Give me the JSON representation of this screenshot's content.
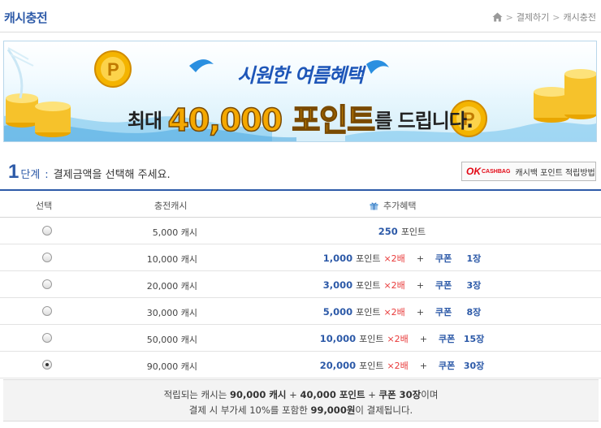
{
  "header": {
    "title": "캐시충전",
    "breadcrumb": [
      "결제하기",
      "캐시충전"
    ]
  },
  "banner": {
    "headline": "시원한 여름혜택",
    "sub_prefix": "최대",
    "sub_amount": "40,000 포인트",
    "sub_suffix": "를 드립니다."
  },
  "step": {
    "number": "1",
    "label": "단계",
    "colon": ":",
    "instruction": "결제금액을 선택해 주세요."
  },
  "okcashbag": {
    "logo_ok": "OK",
    "logo_cashbag": "CASHBAG",
    "label": "캐시백 포인트 적립방법"
  },
  "table": {
    "headers": {
      "select": "선택",
      "cash": "충전캐시",
      "bonus": "추가혜택"
    },
    "rows": [
      {
        "cash": "5,000 캐시",
        "points": "250",
        "unit": "포인트",
        "mult": "",
        "coupon": "",
        "coupon_count": "",
        "selected": false
      },
      {
        "cash": "10,000 캐시",
        "points": "1,000",
        "unit": "포인트",
        "mult": "×2배",
        "coupon": "쿠폰",
        "coupon_count": "1장",
        "selected": false
      },
      {
        "cash": "20,000 캐시",
        "points": "3,000",
        "unit": "포인트",
        "mult": "×2배",
        "coupon": "쿠폰",
        "coupon_count": "3장",
        "selected": false
      },
      {
        "cash": "30,000 캐시",
        "points": "5,000",
        "unit": "포인트",
        "mult": "×2배",
        "coupon": "쿠폰",
        "coupon_count": "8장",
        "selected": false
      },
      {
        "cash": "50,000 캐시",
        "points": "10,000",
        "unit": "포인트",
        "mult": "×2배",
        "coupon": "쿠폰",
        "coupon_count": "15장",
        "selected": false
      },
      {
        "cash": "90,000 캐시",
        "points": "20,000",
        "unit": "포인트",
        "mult": "×2배",
        "coupon": "쿠폰",
        "coupon_count": "30장",
        "selected": true
      }
    ]
  },
  "summary": {
    "l1_a": "적립되는 캐시는",
    "l1_cash": "90,000 캐시",
    "l1_plus1": "+",
    "l1_points": "40,000 포인트",
    "l1_plus2": "+",
    "l1_coupon": "쿠폰 30장",
    "l1_end": "이며",
    "l2_a": "결제 시 부가세 10%를 포함한",
    "l2_amount": "99,000원",
    "l2_end": "이 결제됩니다."
  },
  "colors": {
    "accent": "#2d5aa8",
    "red": "#e83a3a",
    "gold": "#f4a800"
  },
  "icons": [
    "home-icon",
    "chevron-right-icon",
    "gift-icon",
    "coin-icon",
    "wave-icon"
  ]
}
